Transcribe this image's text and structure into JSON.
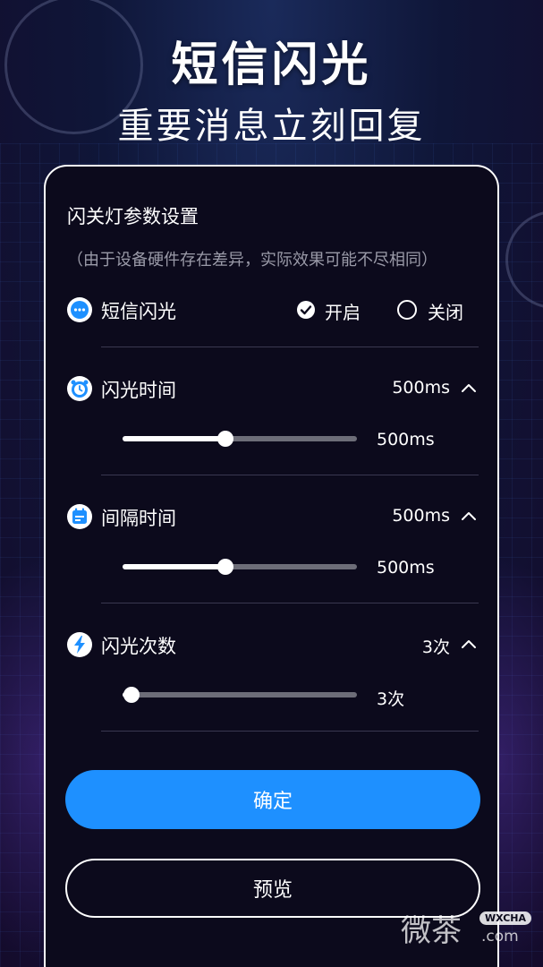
{
  "hero": {
    "title": "短信闪光",
    "subtitle": "重要消息立刻回复"
  },
  "panel": {
    "heading": "闪关灯参数设置",
    "note": "（由于设备硬件存在差异，实际效果可能不尽相同）"
  },
  "sms_flash": {
    "label": "短信闪光",
    "icon": "message-dots-icon",
    "options": {
      "on": "开启",
      "off": "关闭"
    },
    "selected": "on"
  },
  "flash_duration": {
    "label": "闪光时间",
    "icon": "alarm-clock-icon",
    "value": "500ms",
    "slider_value": "500ms",
    "slider_fraction": 0.44
  },
  "interval": {
    "label": "间隔时间",
    "icon": "calendar-icon",
    "value": "500ms",
    "slider_value": "500ms",
    "slider_fraction": 0.44
  },
  "flash_count": {
    "label": "闪光次数",
    "icon": "lightning-icon",
    "value": "3次",
    "slider_value": "3次",
    "slider_fraction": 0.04
  },
  "buttons": {
    "confirm": "确定",
    "preview": "预览"
  },
  "watermark": {
    "text": "微茶",
    "tag": "WXCHA",
    "domain": ".com"
  },
  "colors": {
    "accent": "#1e90ff",
    "panel": "#0c0a1c"
  }
}
